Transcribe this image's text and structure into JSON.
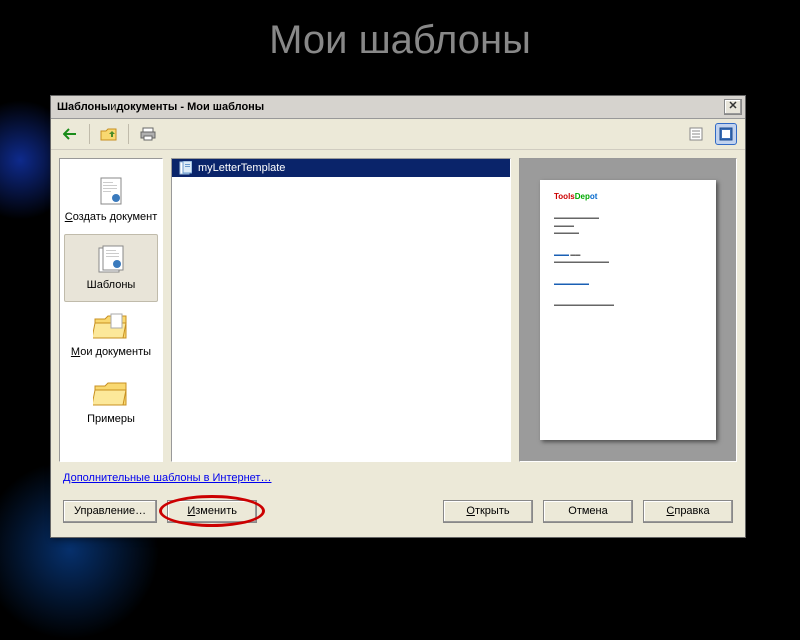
{
  "slide": {
    "title": "Мои шаблоны"
  },
  "dialog": {
    "title_main": "Шаблоны",
    "title_connector": " и ",
    "title_sub": "документы - Мои шаблоны"
  },
  "sidebar": {
    "items": [
      {
        "label": "Создать документ",
        "underline": "С",
        "rest": "оздать документ"
      },
      {
        "label": "Шаблоны",
        "underline": "",
        "rest": "Шаблоны"
      },
      {
        "label": "Мои документы",
        "underline": "М",
        "rest": "ои документы"
      },
      {
        "label": "Примеры",
        "underline": "",
        "rest": "Примеры"
      }
    ]
  },
  "filelist": {
    "items": [
      {
        "name": "myLetterTemplate"
      }
    ]
  },
  "link": {
    "text": "Дополнительные шаблоны в Интернет…"
  },
  "buttons": {
    "manage": "Управление…",
    "edit": "Изменить",
    "open": "Открыть",
    "cancel": "Отмена",
    "help": "Справка"
  },
  "preview": {
    "logo1": "Tools",
    "logo2": "Dep",
    "logo3": "ot"
  }
}
